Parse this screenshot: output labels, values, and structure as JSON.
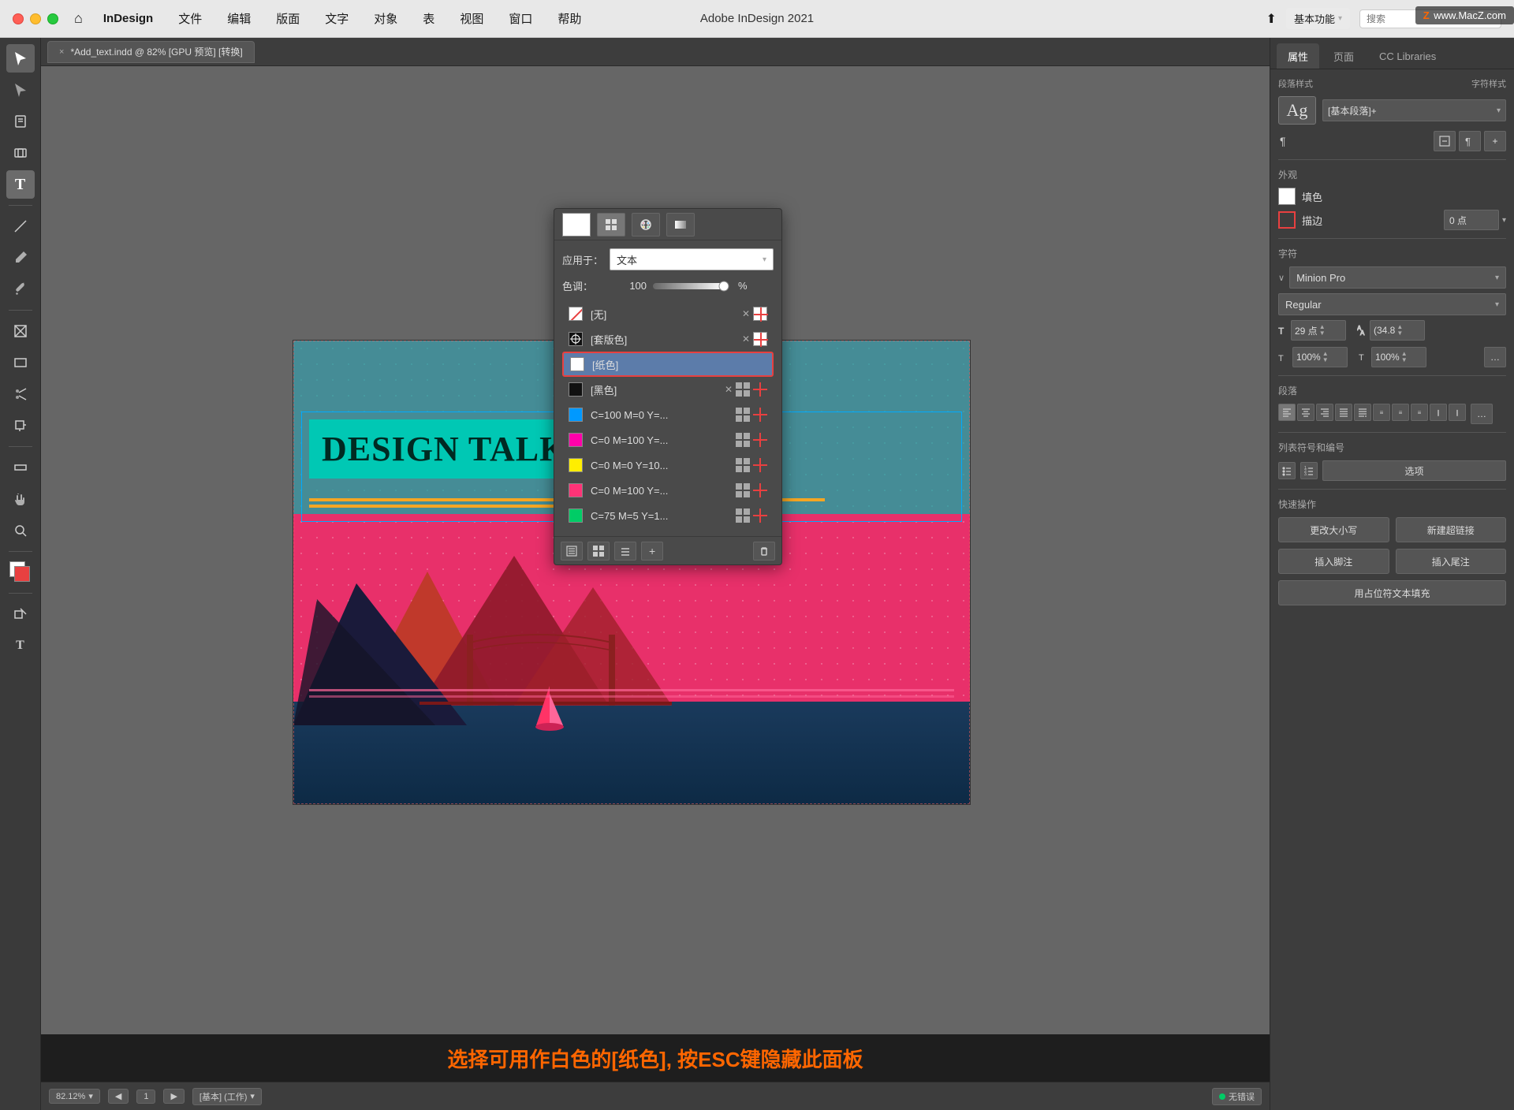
{
  "app": {
    "title": "Adobe InDesign 2021",
    "watermark": "www.MacZ.com",
    "watermark_z": "Z"
  },
  "menu_bar": {
    "apple": "🍎",
    "items": [
      "InDesign",
      "文件",
      "编辑",
      "版面",
      "文字",
      "对象",
      "表",
      "视图",
      "窗口",
      "帮助"
    ]
  },
  "tab": {
    "close": "×",
    "label": "*Add_text.indd @ 82% [GPU 预览] [转换]"
  },
  "toolbar": {
    "icons": [
      "▲",
      "↖",
      "✂",
      "T",
      "/",
      "✏",
      "🔍",
      "☰",
      "✂",
      "↔",
      "✋",
      "🔍"
    ]
  },
  "right_panel": {
    "tabs": [
      "属性",
      "页面",
      "CC Libraries"
    ],
    "active_tab": "属性",
    "paragraph_style": {
      "label": "[基本段落]+",
      "ag_text": "Ag"
    },
    "appearance": {
      "title": "外观",
      "fill_label": "填色",
      "stroke_label": "描边",
      "stroke_value": "0 点"
    },
    "character": {
      "title": "字符",
      "font_name": "Minion Pro",
      "font_style": "Regular",
      "font_size": "29 点",
      "leading": "(34.8",
      "scale_h": "100%",
      "scale_v": "100%"
    },
    "paragraph": {
      "title": "段落"
    },
    "list_section": {
      "title": "列表符号和编号",
      "options_label": "选项"
    },
    "quick_actions": {
      "title": "快速操作",
      "btn1": "更改大小写",
      "btn2": "新建超链接",
      "btn3": "插入脚注",
      "btn4": "插入尾注",
      "btn5": "用占位符文本填充"
    }
  },
  "color_panel": {
    "apply_label": "应用于：",
    "apply_value": "文本",
    "tint_label": "色调：",
    "tint_value": "100",
    "tint_unit": "%",
    "color_items": [
      {
        "name": "[无]",
        "type": "none",
        "has_x": true,
        "has_grid": false,
        "has_reg": true
      },
      {
        "name": "[套版色]",
        "type": "registration",
        "has_x": true,
        "has_grid": false,
        "has_reg": true
      },
      {
        "name": "[纸色]",
        "type": "white",
        "has_x": false,
        "has_grid": false,
        "has_reg": false,
        "selected": true
      },
      {
        "name": "[黑色]",
        "type": "black",
        "has_x": true,
        "has_grid": true,
        "has_reg": true
      },
      {
        "name": "C=100 M=0 Y=...",
        "type": "cyan",
        "has_x": false,
        "has_grid": true,
        "has_reg": true
      },
      {
        "name": "C=0 M=100 Y=...",
        "type": "magenta",
        "has_x": false,
        "has_grid": true,
        "has_reg": true
      },
      {
        "name": "C=0 M=0 Y=10...",
        "type": "yellow",
        "has_x": false,
        "has_grid": true,
        "has_reg": true
      },
      {
        "name": "C=0 M=100 Y=...",
        "type": "pink",
        "has_x": false,
        "has_grid": true,
        "has_reg": true
      },
      {
        "name": "C=75 M=5 Y=1...",
        "type": "green",
        "has_x": false,
        "has_grid": true,
        "has_reg": true
      }
    ]
  },
  "bottom_bar": {
    "zoom": "82.12%",
    "page": "1",
    "page_info": "[基本] (工作)",
    "status": "无错误"
  },
  "instruction": "选择可用作白色的[纸色], 按ESC键隐藏此面板"
}
